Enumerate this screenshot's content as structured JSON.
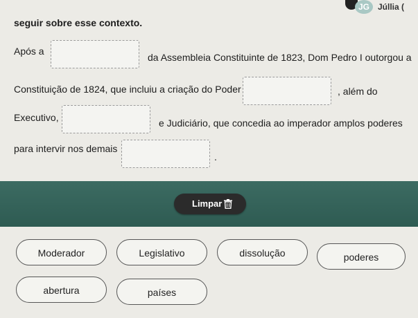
{
  "header": {
    "avatar_initials": "JG",
    "user_name": "Júllia ("
  },
  "instructions": "seguir sobre esse contexto.",
  "sentence": {
    "s1_before": "Após a",
    "s1_after": "da Assembleia Constituinte de 1823, Dom Pedro I outorgou a",
    "s2_before": "Constituição de 1824, que incluiu a criação do Poder",
    "s2_after": ", além do",
    "s3_before": "Executivo,",
    "s3_after": "e Judiciário, que concedia ao imperador amplos poderes",
    "s4_before": "para intervir nos demais",
    "s4_after": "."
  },
  "clear_button": {
    "label": "Limpar",
    "icon": "trash-icon"
  },
  "options": [
    "Moderador",
    "Legislativo",
    "dissolução",
    "poderes",
    "abertura",
    "países"
  ]
}
